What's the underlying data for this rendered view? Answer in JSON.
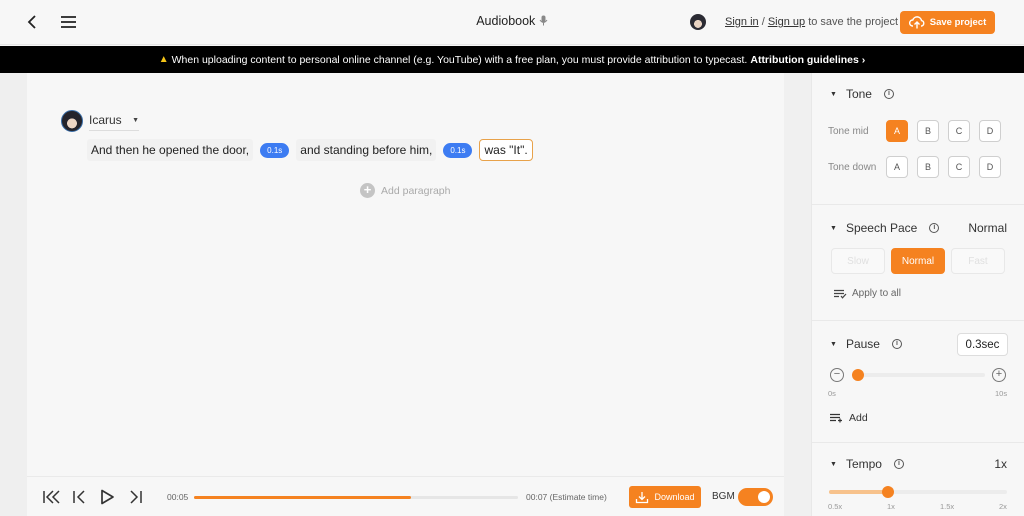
{
  "topbar": {
    "title": "Audiobook",
    "title_icon": "microphone-icon",
    "signin_label": "Sign in",
    "separator": "/",
    "signup_label": "Sign up",
    "signin_suffix": "to save the project",
    "save_label": "Save project"
  },
  "banner": {
    "message": "When uploading content to personal online channel (e.g. YouTube) with a free plan, you must provide attribution to typecast.",
    "link_label": "Attribution guidelines",
    "link_arrow": "›"
  },
  "editor": {
    "speaker_name": "Icarus",
    "segments": [
      {
        "text": "And then he opened the door,"
      },
      {
        "pause": "0.1s"
      },
      {
        "text": "and standing before him,"
      },
      {
        "pause": "0.1s"
      },
      {
        "text": "was \"It\".",
        "active": true
      }
    ],
    "add_paragraph_label": "Add paragraph"
  },
  "player": {
    "current_time": "00:05",
    "total_time": "00:07 (Estimate time)",
    "progress_fraction": 0.67,
    "download_label": "Download",
    "bgm_label": "BGM",
    "bgm_on": true
  },
  "panel": {
    "tone": {
      "title": "Tone",
      "rows": [
        {
          "label": "Tone mid",
          "options": [
            "A",
            "B",
            "C",
            "D"
          ],
          "selected": "A"
        },
        {
          "label": "Tone down",
          "options": [
            "A",
            "B",
            "C",
            "D"
          ],
          "selected": null
        }
      ]
    },
    "speech_pace": {
      "title": "Speech Pace",
      "value": "Normal",
      "options": [
        "Slow",
        "Normal",
        "Fast"
      ],
      "selected": "Normal",
      "apply_all_label": "Apply to all"
    },
    "pause": {
      "title": "Pause",
      "value": "0.3sec",
      "min_label": "0s",
      "max_label": "10s",
      "slider_value": 0.3,
      "slider_max": 10,
      "add_label": "Add"
    },
    "tempo": {
      "title": "Tempo",
      "value": "1x",
      "ticks": [
        "0.5x",
        "1x",
        "1.5x",
        "2x"
      ],
      "slider_value": 1,
      "slider_min": 0.5,
      "slider_max": 2
    }
  },
  "colors": {
    "accent": "#f58220",
    "pause_chip": "#3d7cf2",
    "banner_bg": "#000000"
  }
}
